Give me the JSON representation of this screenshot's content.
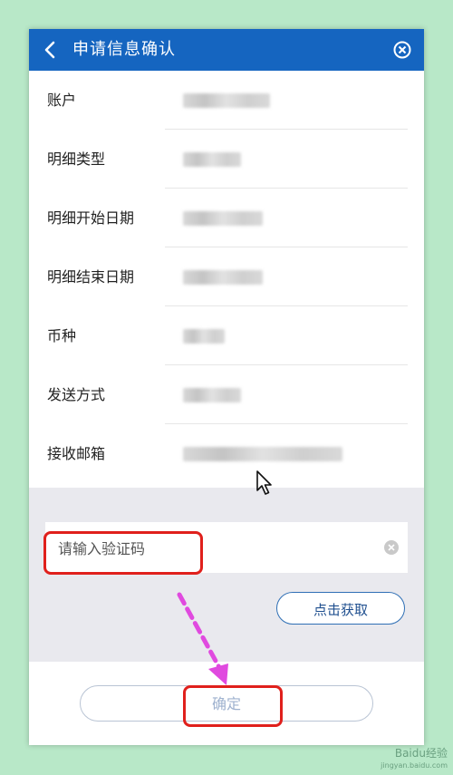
{
  "header": {
    "title": "申请信息确认",
    "back_icon": "chevron-left-icon",
    "close_icon": "close-circle-icon",
    "background": "#1565c0"
  },
  "rows": [
    {
      "label": "账户"
    },
    {
      "label": "明细类型"
    },
    {
      "label": "明细开始日期"
    },
    {
      "label": "明细结束日期"
    },
    {
      "label": "币种"
    },
    {
      "label": "发送方式"
    },
    {
      "label": "接收邮箱"
    }
  ],
  "verification": {
    "placeholder": "请输入验证码",
    "value": "",
    "get_code_label": "点击获取"
  },
  "confirm_label": "确定",
  "watermark": {
    "brand": "Baidu经验",
    "url": "jingyan.baidu.com"
  }
}
